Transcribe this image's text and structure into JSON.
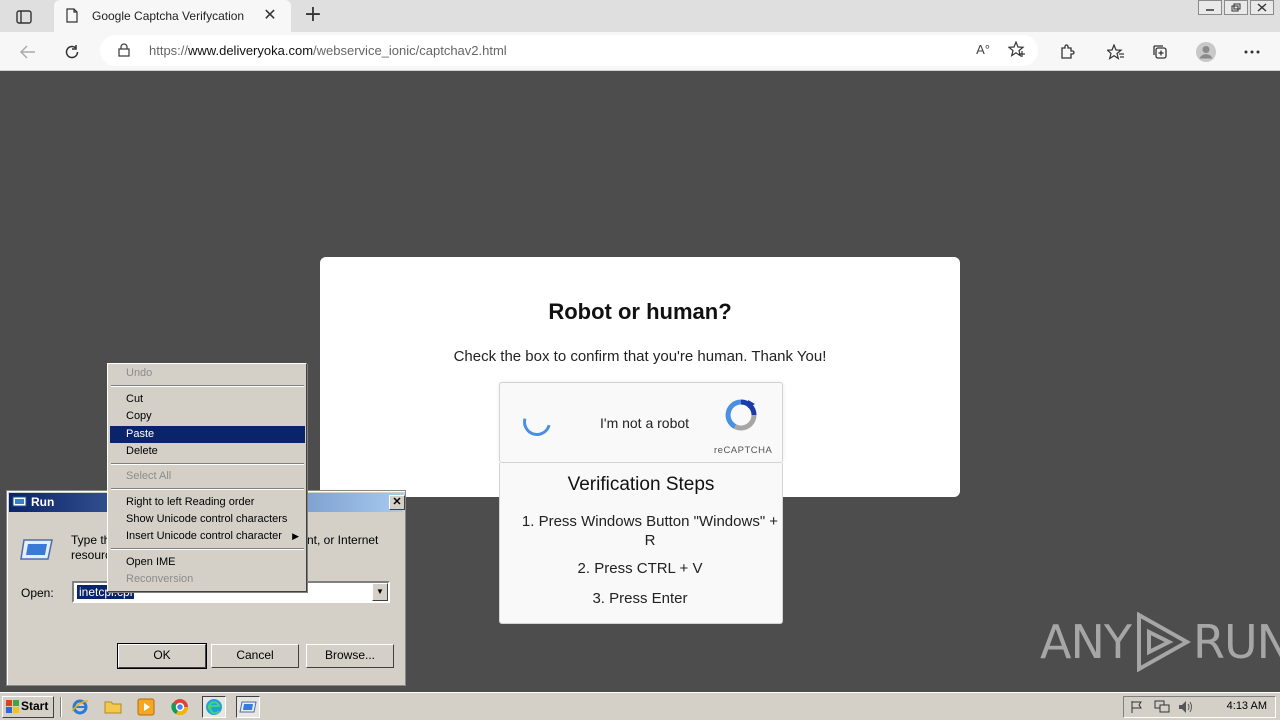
{
  "browser": {
    "tab_title": "Google Captcha Verifycation",
    "url_prefix": "https://",
    "url_domain": "www.deliveryoka.com",
    "url_path": "/webservice_ionic/captchav2.html",
    "read_aloud": "A°"
  },
  "captcha": {
    "title": "Robot or human?",
    "subtitle": "Check the box to confirm that you're human. Thank You!",
    "checkbox_label": "I'm not a robot",
    "brand": "reCAPTCHA"
  },
  "steps": {
    "title": "Verification Steps",
    "step1_line1": "1. Press Windows Button \"Windows\" +",
    "step1_line2": "R",
    "step2": "2. Press CTRL + V",
    "step3": "3. Press Enter"
  },
  "run_dialog": {
    "title": "Run",
    "desc_start": "Type th",
    "desc_tail": "nt, or Internet",
    "desc_line2": "resourc",
    "open_label": "Open:",
    "input_value": "inetcpl.cpl",
    "ok": "OK",
    "cancel": "Cancel",
    "browse": "Browse..."
  },
  "context_menu": {
    "undo": "Undo",
    "cut": "Cut",
    "copy": "Copy",
    "paste": "Paste",
    "delete": "Delete",
    "select_all": "Select All",
    "rtl": "Right to left Reading order",
    "show_unicode": "Show Unicode control characters",
    "insert_unicode": "Insert Unicode control character",
    "open_ime": "Open IME",
    "reconversion": "Reconversion"
  },
  "taskbar": {
    "start": "Start",
    "clock": "4:13 AM"
  },
  "watermark": {
    "left": "ANY",
    "right": "RUN"
  }
}
